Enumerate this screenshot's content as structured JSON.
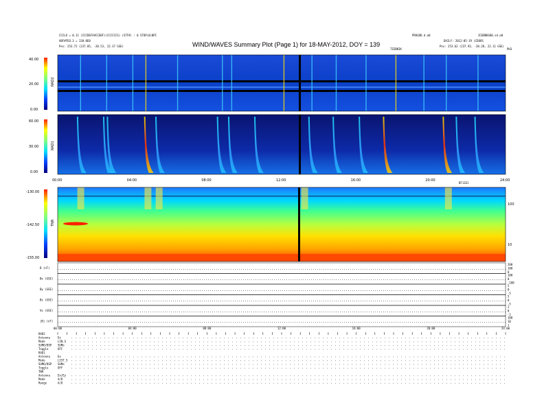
{
  "header": {
    "title": "WIND/WAVES Summary Plot (Page 1) for 18-MAY-2012, DOY = 139",
    "meta_left_1": "CCCLO = 0.11 (CCCDEFAVCCEBF)(CCCCCCS) (STF#) : 0 STOP(0)BPC",
    "meta_left_2": "ABF#FEO.3 = 130.0E0",
    "meta_left_3": "Pos:  253.72 (237.85, -20.53, 22.37 GSE)",
    "meta_center_1": "PROGOD.d.a0",
    "meta_center_2": "TIEBNIK",
    "meta_right_1": "ICEBNOGO0.sd.a0",
    "meta_right_2": "DAILY: 2012-05-19 (CDOOS",
    "meta_right_3": "Pos:  253.62 (237.92, -20.28, 22.11 GSE)",
    "meta_right_4": "PH3",
    "tnr_corner": "BF11E1",
    "tnr_right_top": "100",
    "tnr_right_bot": "10"
  },
  "colors": {
    "spectrogram_background": "#0a3cc8",
    "rad1_background": "#0d1e8c",
    "tnr_low": "#1e78ff",
    "tnr_mid": "#40ff90",
    "tnr_high": "#ffd800",
    "tnr_floor": "#ff4800",
    "gap_line": "#000000"
  },
  "chart_data": [
    {
      "type": "heatmap",
      "name": "RAD2",
      "ylabel": "RAD2",
      "colorbar_ticks": [
        "40.00",
        "20.00",
        "0.00"
      ],
      "ylim": [
        0,
        40
      ],
      "xlim_hours": [
        0,
        24
      ],
      "data_gap_hour": 12.9,
      "bursts_hours": [
        1.2,
        2.6,
        4.0,
        4.7,
        6.4,
        8.8,
        9.3,
        12.1,
        13.6,
        14.9,
        16.5,
        18.1,
        19.6,
        20.8,
        22.5
      ]
    },
    {
      "type": "heatmap",
      "name": "RAD1",
      "ylabel": "RAD1",
      "colorbar_ticks": [
        "60.00",
        "30.00",
        "0.00"
      ],
      "ylim": [
        0,
        60
      ],
      "x_ticks": [
        "00:00",
        "04:00",
        "08:00",
        "12:00",
        "16:00",
        "20:00",
        "24:00"
      ],
      "data_gap_hour": 12.9,
      "bursts_hours": [
        1.1,
        2.5,
        2.7,
        4.7,
        5.3,
        8.6,
        9.2,
        10.6,
        13.5,
        14.8,
        16.2,
        17.5,
        20.7,
        21.4,
        22.4
      ]
    },
    {
      "type": "heatmap",
      "name": "TNR",
      "ylabel": "TNR",
      "colorbar_ticks": [
        "-130.00",
        "-142.50",
        "-155.00"
      ],
      "ylim": [
        -155,
        -130
      ],
      "right_axis_ticks": [
        "100",
        "10"
      ],
      "data_gap_hour": 12.9,
      "bursts_hours": [
        1.2,
        4.8,
        5.4,
        13.2,
        20.9
      ]
    },
    {
      "type": "line",
      "name": "housekeeping",
      "row_labels": [
        "B (nT)",
        "Bx (GSE)",
        "By (GSE)",
        "Bz (GSE)",
        "Vx (GSE)",
        "|B| (nT)"
      ],
      "right_ticks": [
        [
          "200",
          "100",
          "0"
        ],
        [
          "100",
          "0",
          "-100"
        ],
        [
          "5",
          "0",
          "-5"
        ],
        [
          "5",
          "0",
          "-5"
        ],
        [
          "2",
          "0",
          "-2"
        ],
        [
          "100",
          "10",
          "1"
        ]
      ],
      "x_ticks": [
        "00:00",
        "04:00",
        "08:00",
        "12:00",
        "16:00",
        "20:00",
        "24:00"
      ]
    }
  ],
  "footer": {
    "groups": [
      {
        "label": "RAD2",
        "rows": [
          [
            "Antenna",
            "Ex"
          ],
          [
            "Mode",
            "LIN_S"
          ],
          [
            "SUMO/BSP",
            "SUMo"
          ],
          [
            "Toggle",
            "OFF"
          ]
        ]
      },
      {
        "label": "RAD1",
        "rows": [
          [
            "Antenna",
            "Ex"
          ],
          [
            "Mode",
            "LIST_S"
          ],
          [
            "SUMO/BSP",
            "SUMo"
          ],
          [
            "Toggle",
            "OFF"
          ]
        ]
      },
      {
        "label": "TNR",
        "rows": [
          [
            "Antenna",
            "Ex/Ey"
          ],
          [
            "Mode",
            "A/D"
          ],
          [
            "Range",
            "A/D"
          ]
        ]
      }
    ]
  }
}
